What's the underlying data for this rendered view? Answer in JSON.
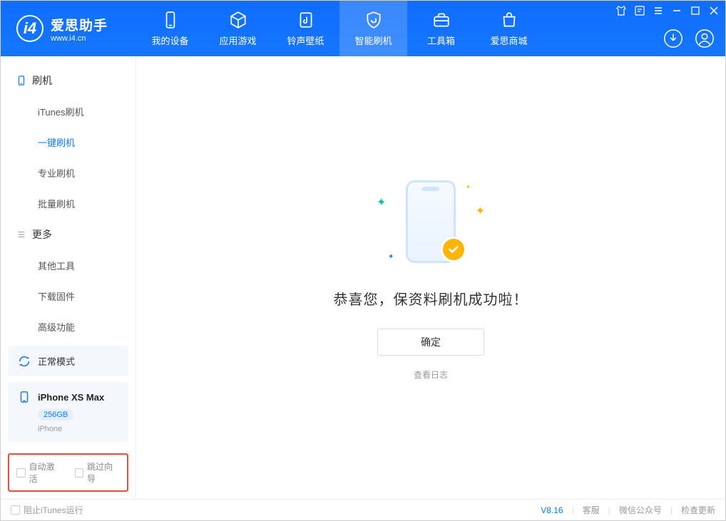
{
  "app": {
    "title": "爱思助手",
    "url": "www.i4.cn"
  },
  "nav": [
    {
      "label": "我的设备"
    },
    {
      "label": "应用游戏"
    },
    {
      "label": "铃声壁纸"
    },
    {
      "label": "智能刷机"
    },
    {
      "label": "工具箱"
    },
    {
      "label": "爱思商城"
    }
  ],
  "sidebar": {
    "group1_label": "刷机",
    "items1": [
      {
        "label": "iTunes刷机"
      },
      {
        "label": "一键刷机"
      },
      {
        "label": "专业刷机"
      },
      {
        "label": "批量刷机"
      }
    ],
    "group2_label": "更多",
    "items2": [
      {
        "label": "其他工具"
      },
      {
        "label": "下载固件"
      },
      {
        "label": "高级功能"
      }
    ]
  },
  "mode_panel": {
    "label": "正常模式"
  },
  "device": {
    "name": "iPhone XS Max",
    "storage": "256GB",
    "sub": "iPhone"
  },
  "options": {
    "auto_activate": "自动激活",
    "skip_wizard": "跳过向导"
  },
  "result": {
    "title": "恭喜您，保资料刷机成功啦！",
    "ok_button": "确定",
    "view_log": "查看日志"
  },
  "footer": {
    "block_itunes": "阻止iTunes运行",
    "version": "V8.16",
    "links": [
      "客服",
      "微信公众号",
      "检查更新"
    ]
  }
}
